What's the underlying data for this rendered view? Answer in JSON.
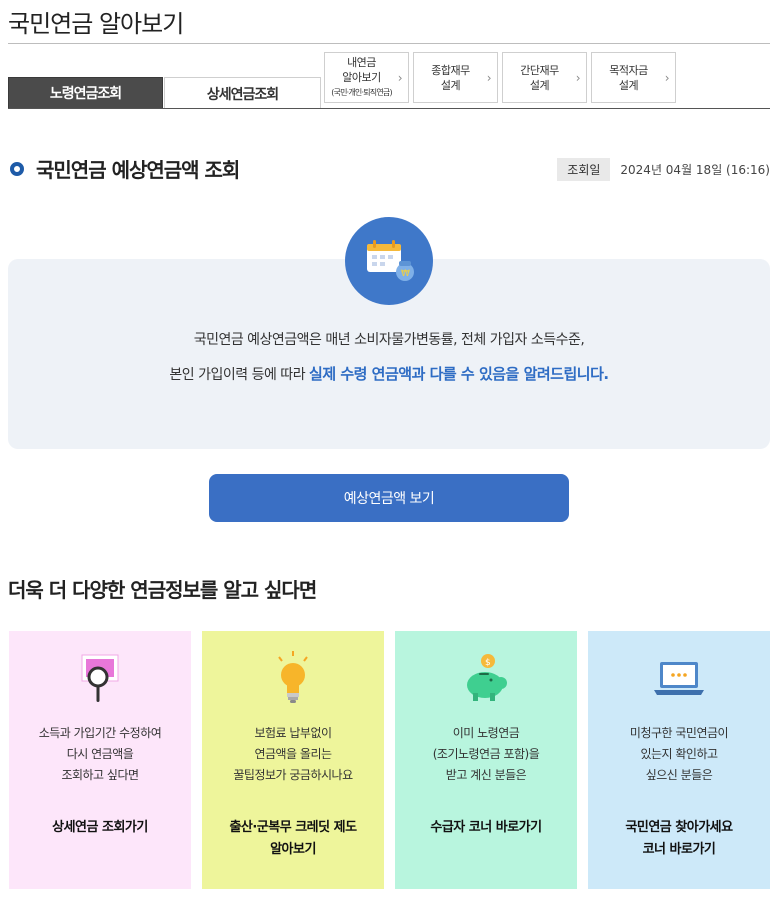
{
  "page": {
    "title": "국민연금 알아보기"
  },
  "tabs": {
    "main": [
      {
        "label": "노령연금조회",
        "active": true
      },
      {
        "label": "상세연금조회",
        "active": false
      }
    ],
    "small": [
      {
        "line1": "내연금",
        "line2": "알아보기",
        "sub": "(국민·개인·퇴직연금)"
      },
      {
        "line1": "종합재무",
        "line2": "설계"
      },
      {
        "line1": "간단재무",
        "line2": "설계"
      },
      {
        "line1": "목적자금",
        "line2": "설계"
      }
    ]
  },
  "section": {
    "title": "국민연금 예상연금액 조회",
    "query_label": "조회일",
    "query_date": "2024년 04월 18일 (16:16)"
  },
  "info": {
    "line1": "국민연금 예상연금액은 매년 소비자물가변동률, 전체 가입자 소득수준,",
    "line2_prefix": "본인 가입이력 등에 따라 ",
    "line2_highlight": "실제 수령 연금액과 다를 수 있음을 알려드립니다."
  },
  "cta": {
    "label": "예상연금액 보기"
  },
  "more": {
    "title": "더욱 더 다양한 연금정보를 알고 싶다면",
    "cards": [
      {
        "icon": "magnifier-icon",
        "desc": [
          "소득과 가입기간 수정하여",
          "다시 연금액을",
          "조회하고 싶다면"
        ],
        "link": [
          "상세연금 조회가기"
        ]
      },
      {
        "icon": "lightbulb-icon",
        "desc": [
          "보험료 납부없이",
          "연금액을 올리는",
          "꿀팁정보가 궁금하시나요"
        ],
        "link": [
          "출산·군복무 크레딧 제도",
          "알아보기"
        ]
      },
      {
        "icon": "piggy-bank-icon",
        "desc": [
          "이미 노령연금",
          "(조기노령연금 포함)을",
          "받고 계신 분들은"
        ],
        "link": [
          "수급자 코너 바로가기"
        ]
      },
      {
        "icon": "laptop-icon",
        "desc": [
          "미청구한 국민연금이",
          "있는지 확인하고",
          "싶으신 분들은"
        ],
        "link": [
          "국민연금 찾아가세요",
          "코너 바로가기"
        ]
      }
    ]
  },
  "colors": {
    "primary_blue": "#3a6fc4",
    "tab_active": "#4b4b4b",
    "card_pink": "#fde6fa",
    "card_yellow": "#eef59b",
    "card_mint": "#b8f5de",
    "card_sky": "#cde9f9"
  }
}
